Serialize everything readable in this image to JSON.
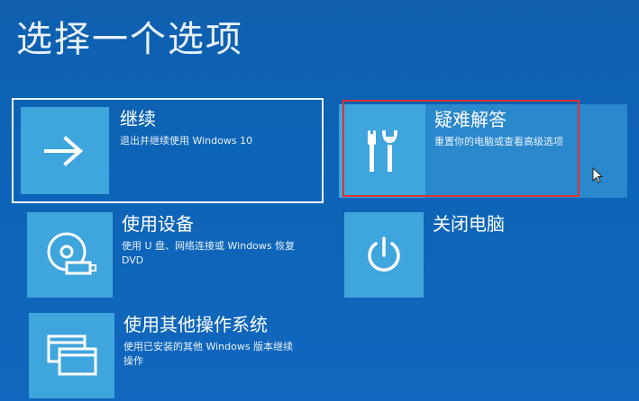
{
  "page": {
    "title": "选择一个选项"
  },
  "options": {
    "continue": {
      "label": "继续",
      "desc": "退出并继续使用 Windows 10",
      "icon": "arrow-right-icon"
    },
    "use_device": {
      "label": "使用设备",
      "desc": "使用 U 盘、网络连接或 Windows 恢复 DVD",
      "icon": "disc-usb-icon"
    },
    "other_os": {
      "label": "使用其他操作系统",
      "desc": "使用已安装的其他 Windows 版本继续操作",
      "icon": "windows-stack-icon"
    },
    "troubleshoot": {
      "label": "疑难解答",
      "desc": "重置你的电脑或查看高级选项",
      "icon": "tools-icon"
    },
    "shutdown": {
      "label": "关闭电脑",
      "icon": "power-icon"
    }
  },
  "colors": {
    "background": "#0f5fae",
    "tile_icon": "#3fa5dd",
    "highlight": "#e0332e"
  }
}
